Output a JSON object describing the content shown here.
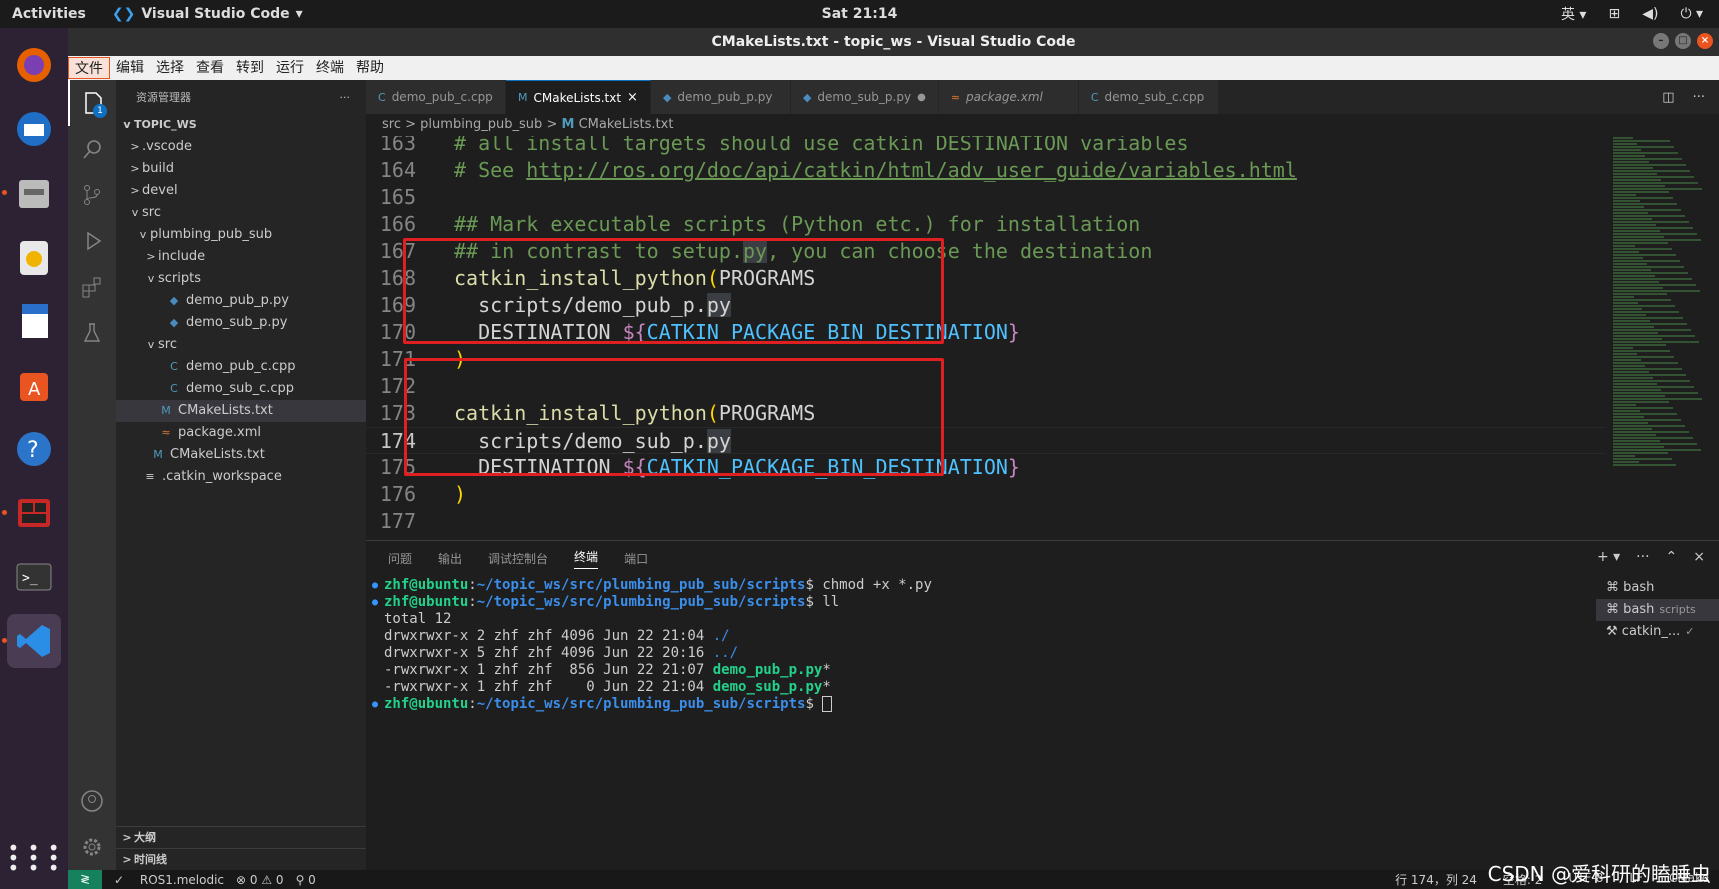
{
  "topbar": {
    "activities": "Activities",
    "app_name": "Visual Studio Code",
    "clock": "Sat 21:14",
    "input_method": "英"
  },
  "window": {
    "title": "CMakeLists.txt - topic_ws - Visual Studio Code"
  },
  "menu": [
    "文件",
    "编辑",
    "选择",
    "查看",
    "转到",
    "运行",
    "终端",
    "帮助"
  ],
  "activity_bar": {
    "explorer_badge": "1"
  },
  "sidebar": {
    "title": "资源管理器",
    "more": "···",
    "root": "TOPIC_WS",
    "tree": [
      {
        "label": ".vscode",
        "indent": 1,
        "chev": ">"
      },
      {
        "label": "build",
        "indent": 1,
        "chev": ">"
      },
      {
        "label": "devel",
        "indent": 1,
        "chev": ">"
      },
      {
        "label": "src",
        "indent": 1,
        "chev": "v"
      },
      {
        "label": "plumbing_pub_sub",
        "indent": 2,
        "chev": "v"
      },
      {
        "label": "include",
        "indent": 3,
        "chev": ">"
      },
      {
        "label": "scripts",
        "indent": 3,
        "chev": "v"
      },
      {
        "label": "demo_pub_p.py",
        "indent": 4,
        "icon": "py"
      },
      {
        "label": "demo_sub_p.py",
        "indent": 4,
        "icon": "py"
      },
      {
        "label": "src",
        "indent": 3,
        "chev": "v"
      },
      {
        "label": "demo_pub_c.cpp",
        "indent": 4,
        "icon": "cpp"
      },
      {
        "label": "demo_sub_c.cpp",
        "indent": 4,
        "icon": "cpp"
      },
      {
        "label": "CMakeLists.txt",
        "indent": 3,
        "icon": "M",
        "selected": true
      },
      {
        "label": "package.xml",
        "indent": 3,
        "icon": "xml"
      },
      {
        "label": "CMakeLists.txt",
        "indent": 2,
        "icon": "M"
      },
      {
        "label": ".catkin_workspace",
        "indent": 1,
        "icon": "list"
      }
    ],
    "outline": "大纲",
    "timeline": "时间线"
  },
  "tabs": [
    {
      "label": "demo_pub_c.cpp",
      "icon": "C",
      "active": false
    },
    {
      "label": "CMakeLists.txt",
      "icon": "M",
      "active": true,
      "close": "×"
    },
    {
      "label": "demo_pub_p.py",
      "icon": "py",
      "active": false
    },
    {
      "label": "demo_sub_p.py",
      "icon": "py",
      "active": false,
      "dirty": "●"
    },
    {
      "label": "package.xml",
      "icon": "xml",
      "active": false
    },
    {
      "label": "demo_sub_c.cpp",
      "icon": "C",
      "active": false
    }
  ],
  "breadcrumb": {
    "part1": "src",
    "sep": ">",
    "part2": "plumbing_pub_sub",
    "part3": "CMakeLists.txt"
  },
  "code": {
    "lines": [
      {
        "n": "163",
        "t": "# all install targets should use catkin DESTINATION variables"
      },
      {
        "n": "164",
        "t": "# See http://ros.org/doc/api/catkin/html/adv_user_guide/variables.html"
      },
      {
        "n": "165",
        "t": ""
      },
      {
        "n": "166",
        "t": "## Mark executable scripts (Python etc.) for installation"
      },
      {
        "n": "167",
        "t": "## in contrast to setup.py, you can choose the destination"
      },
      {
        "n": "168",
        "t": "catkin_install_python(PROGRAMS"
      },
      {
        "n": "169",
        "t": "  scripts/demo_pub_p.py"
      },
      {
        "n": "170",
        "t": "  DESTINATION ${CATKIN_PACKAGE_BIN_DESTINATION}"
      },
      {
        "n": "171",
        "t": ")"
      },
      {
        "n": "172",
        "t": ""
      },
      {
        "n": "173",
        "t": "catkin_install_python(PROGRAMS"
      },
      {
        "n": "174",
        "t": "  scripts/demo_sub_p.py"
      },
      {
        "n": "175",
        "t": "  DESTINATION ${CATKIN_PACKAGE_BIN_DESTINATION}"
      },
      {
        "n": "176",
        "t": ")"
      },
      {
        "n": "177",
        "t": ""
      }
    ],
    "current_line": "174"
  },
  "panel": {
    "tabs": [
      "问题",
      "输出",
      "调试控制台",
      "终端",
      "端口"
    ],
    "active_tab": "终端",
    "terminal": {
      "prompt_user": "zhf@ubuntu",
      "prompt_path": "~/topic_ws/src/plumbing_pub_sub/scripts",
      "cmd1": "chmod +x *.py",
      "cmd2": "ll",
      "out_total": "total 12",
      "out_l1": "drwxrwxr-x 2 zhf zhf 4096 Jun 22 21:04 ",
      "out_l1_name": "./",
      "out_l2": "drwxrwxr-x 5 zhf zhf 4096 Jun 22 20:16 ",
      "out_l2_name": "../",
      "out_l3": "-rwxrwxr-x 1 zhf zhf  856 Jun 22 21:07 ",
      "out_l3_name": "demo_pub_p.py",
      "out_l4": "-rwxrwxr-x 1 zhf zhf    0 Jun 22 21:04 ",
      "out_l4_name": "demo_sub_p.py",
      "star": "*"
    },
    "terminals": [
      {
        "label": "bash",
        "sub": ""
      },
      {
        "label": "bash",
        "sub": "scripts"
      },
      {
        "label": "catkin_...",
        "sub": "✓"
      }
    ]
  },
  "status": {
    "remote": "≷",
    "ros": "ROS1.melodic",
    "problems": "⊗ 0 ⚠ 0",
    "ports": "⚲ 0",
    "position": "行 174，列 24",
    "spaces": "空格: 2",
    "encoding": "UTF-8",
    "eol": "LF",
    "lang": "CMake"
  },
  "watermark": "CSDN @爱科研的瞌睡虫",
  "colors": {
    "accent": "#0e70c0",
    "highlight_box": "#e02020",
    "dock": "#2d2233"
  }
}
